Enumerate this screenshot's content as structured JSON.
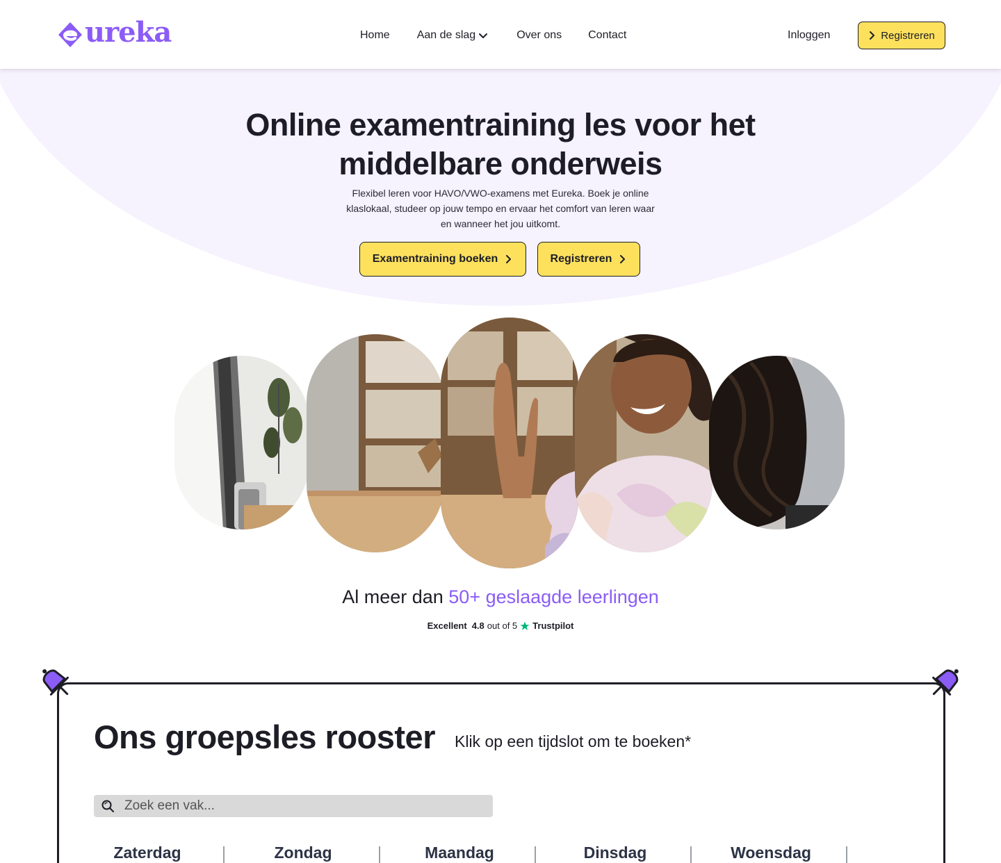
{
  "header": {
    "logo_text": "ureka",
    "nav": [
      {
        "label": "Home"
      },
      {
        "label": "Aan de slag"
      },
      {
        "label": "Over ons"
      },
      {
        "label": "Contact"
      }
    ],
    "login_label": "Inloggen",
    "register_label": "Registreren"
  },
  "hero": {
    "title_line1": "Online examentraining les voor het",
    "title_line2": "middelbare onderweis",
    "subtitle": "Flexibel leren voor HAVO/VWO-examens met Eureka. Boek je online klaslokaal, studeer op jouw tempo en ervaar het comfort van leren waar en wanneer het jou uitkomt.",
    "book_button": "Examentraining boeken",
    "register_button": "Registreren"
  },
  "stats": {
    "prefix": "Al meer dan ",
    "highlight": "50+ geslaagde leerlingen"
  },
  "trustpilot": {
    "rating_word": "Excellent",
    "score": "4.8",
    "out_of": "out of 5",
    "brand": "Trustpilot"
  },
  "schedule": {
    "title": "Ons groepsles rooster",
    "hint": "Klik op een tijdslot om te boeken*",
    "search_placeholder": "Zoek een vak...",
    "days": [
      "Zaterdag",
      "Zondag",
      "Maandag",
      "Dinsdag",
      "Woensdag"
    ]
  },
  "colors": {
    "accent_purple": "#8b5cf6",
    "button_yellow": "#fde15d",
    "hero_bg": "#f6f2fe",
    "trustpilot_green": "#00b67a"
  }
}
